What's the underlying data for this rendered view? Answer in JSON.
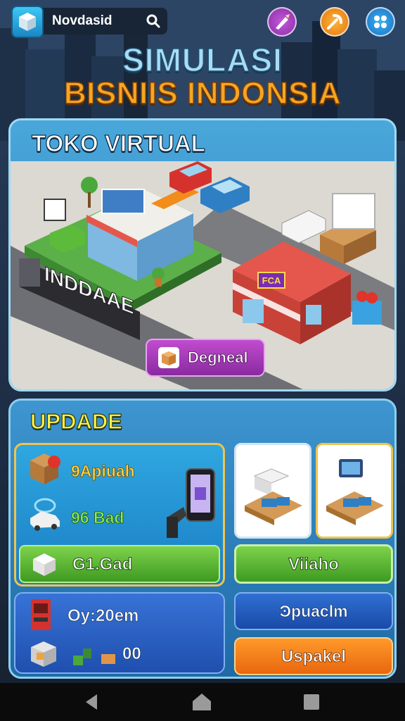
{
  "header": {
    "app_name": "Novdasid",
    "icons": [
      "cube-logo-icon",
      "search-icon",
      "pencil-wand-icon",
      "pickaxe-icon",
      "menu-grid-icon"
    ]
  },
  "title": {
    "line1": "SIMULASI",
    "line2": "BISNIIS INDONSIA"
  },
  "store": {
    "title": "TOKO VIRTUAL",
    "sign_label": "INDDAAE",
    "shop_sign": "FCA",
    "cta_label": "Degneal"
  },
  "update": {
    "title": "UPDADE",
    "stats": [
      {
        "label": "9Apiuah",
        "icon": "box-icon",
        "color": "#ffd84a"
      },
      {
        "label": "96 Bad",
        "icon": "car-icon",
        "color": "#8cf05a"
      }
    ],
    "green_label": "G1.Gad",
    "green_button": "Viiaho",
    "blue_button": "Ͽpuaclm",
    "orange_button": "Uspakel",
    "info": {
      "time": "Oy:20em",
      "count": "00"
    }
  },
  "nav": {
    "icons": [
      "back-icon",
      "home-icon",
      "recents-icon"
    ]
  },
  "colors": {
    "accent_gold": "#f5a623",
    "panel_blue": "#2a80bd",
    "green": "#4caf2a",
    "orange": "#f28c1a",
    "purple": "#9b33b3"
  }
}
